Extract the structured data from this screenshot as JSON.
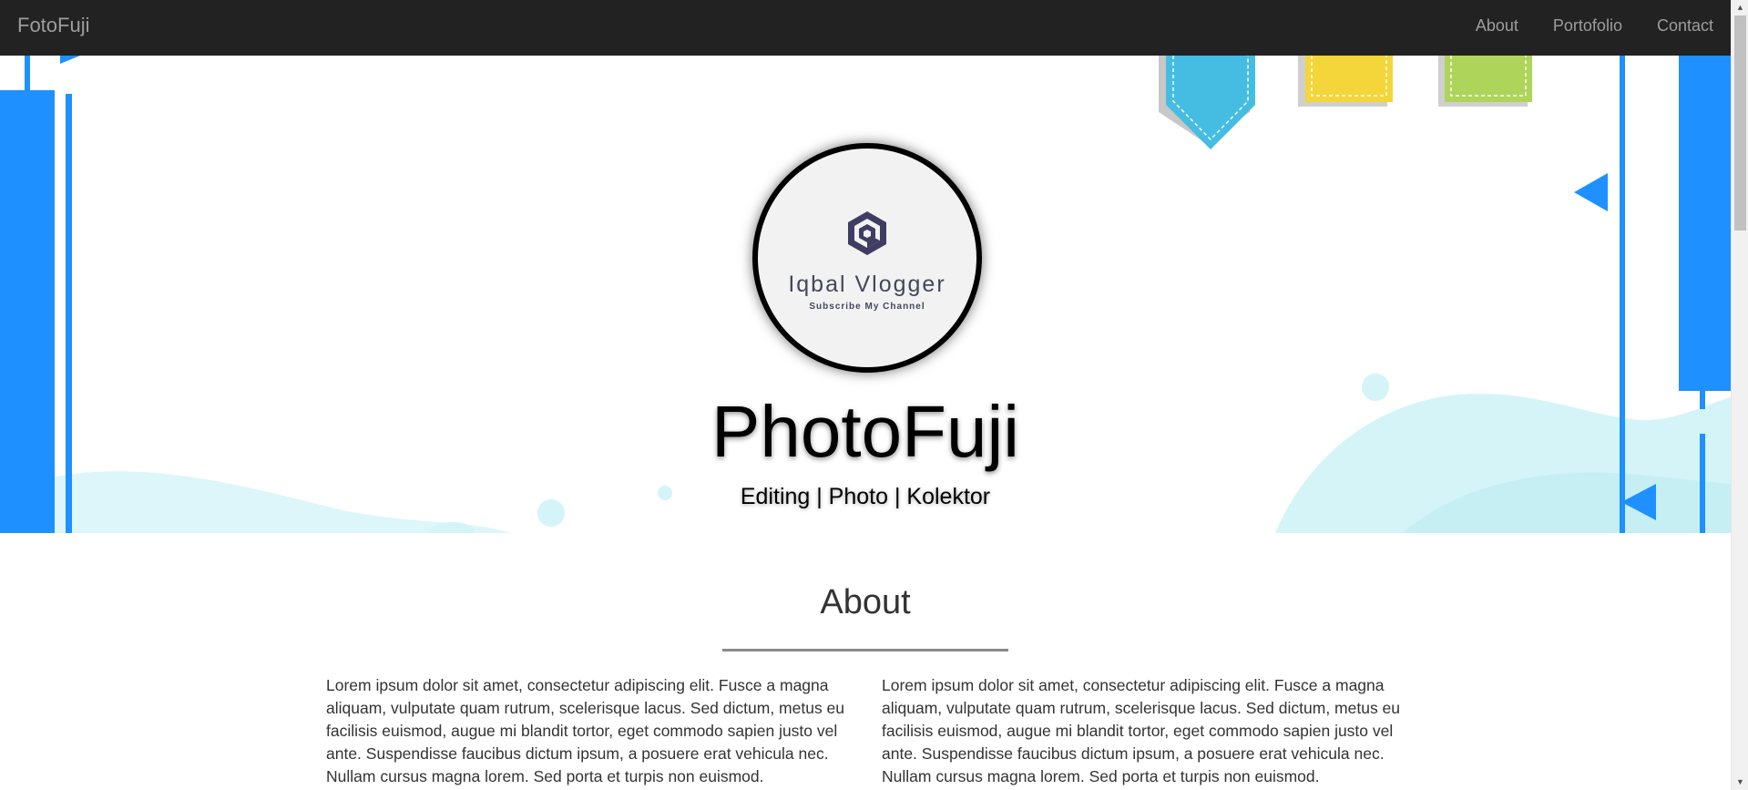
{
  "navbar": {
    "brand": "FotoFuji",
    "links": [
      "About",
      "Portofolio",
      "Contact"
    ]
  },
  "hero": {
    "avatar_name": "Iqbal Vlogger",
    "avatar_tagline": "Subscribe My Channel",
    "title": "PhotoFuji",
    "subtitle": "Editing | Photo | Kolektor"
  },
  "about": {
    "title": "About",
    "col_left": "Lorem ipsum dolor sit amet, consectetur adipiscing elit. Fusce a magna aliquam, vulputate quam rutrum, scelerisque lacus. Sed dictum, metus eu facilisis euismod, augue mi blandit tortor, eget commodo sapien justo vel ante. Suspendisse faucibus dictum ipsum, a posuere erat vehicula nec. Nullam cursus magna lorem. Sed porta et turpis non euismod.",
    "col_right": "Lorem ipsum dolor sit amet, consectetur adipiscing elit. Fusce a magna aliquam, vulputate quam rutrum, scelerisque lacus. Sed dictum, metus eu facilisis euismod, augue mi blandit tortor, eget commodo sapien justo vel ante. Suspendisse faucibus dictum ipsum, a posuere erat vehicula nec. Nullam cursus magna lorem. Sed porta et turpis non euismod."
  },
  "colors": {
    "navbar_bg": "#222222",
    "nav_text": "#9d9d9d",
    "accent_blue": "#1e90ff",
    "light_cyan": "#d4f4f8"
  },
  "icons": [
    "avatar-logo-icon",
    "arrow-up-icon",
    "arrow-down-icon"
  ]
}
